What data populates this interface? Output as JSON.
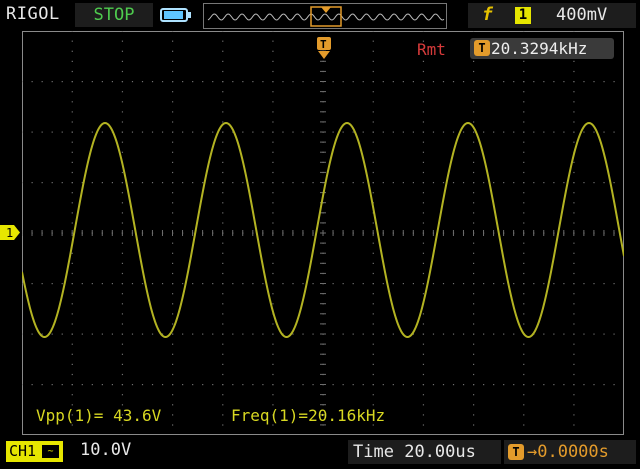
{
  "header": {
    "brand": "RIGOL",
    "run_status": "STOP",
    "trigger_edge_icon": "rising-edge-icon",
    "trigger_source": "1",
    "trigger_level": "400mV"
  },
  "screen": {
    "remote_label": "Rmt",
    "frequency_counter": "20.3294kHz",
    "trigger_position_marker": "T",
    "channel_marker": "1",
    "trace_color": "#b3b322",
    "grid_color": "#6e6e6e"
  },
  "measurements": {
    "vpp": "Vpp(1)= 43.6V",
    "freq": "Freq(1)=20.16kHz"
  },
  "footer": {
    "channel_label": "CH1",
    "channel_coupling": "AC",
    "vertical_scale": "10.0V",
    "time_label": "Time",
    "time_base": "20.00us",
    "trigger_offset": "→0.0000s"
  }
}
